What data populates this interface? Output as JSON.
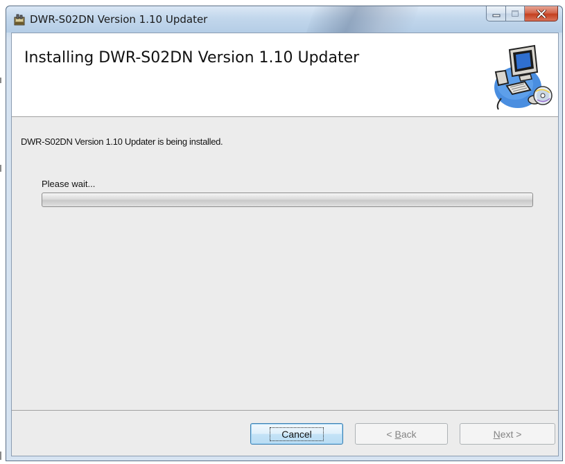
{
  "window": {
    "title": "DWR-S02DN Version 1.10 Updater",
    "icon": "installer-icon"
  },
  "banner": {
    "title": "Installing DWR-S02DN Version 1.10 Updater",
    "image": "computer-cd-icon"
  },
  "content": {
    "description": "DWR-S02DN Version 1.10 Updater is being installed.",
    "wait_label": "Please wait...",
    "progress": 0
  },
  "buttons": {
    "cancel": "Cancel",
    "back_prefix": "< ",
    "back_mnemonic": "B",
    "back_rest": "ack",
    "next_mnemonic": "N",
    "next_rest": "ext >"
  },
  "colors": {
    "titlebar": "#c2d7ec",
    "close_button": "#c4401f",
    "client_background": "#ececec",
    "progress_fill": "#3aa02e"
  }
}
